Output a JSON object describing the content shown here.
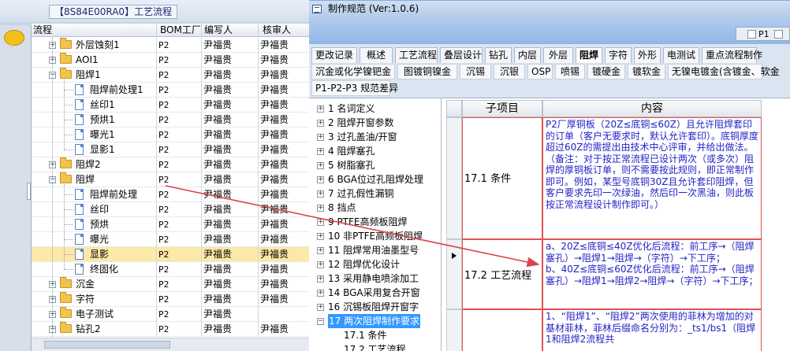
{
  "left_window": {
    "title": "【8S84E00RA0】工艺流程",
    "columns": [
      "流程",
      "BOM工厂",
      "编写人",
      "核审人"
    ],
    "rows": [
      {
        "label": "外层蚀刻1",
        "bom": "P2",
        "writer": "尹福贵",
        "reviewer": "尹福贵",
        "type": "folder",
        "level": 1,
        "exp": "+"
      },
      {
        "label": "AOI1",
        "bom": "P2",
        "writer": "尹福贵",
        "reviewer": "尹福贵",
        "type": "folder",
        "level": 1,
        "exp": "+"
      },
      {
        "label": "阻焊1",
        "bom": "P2",
        "writer": "尹福贵",
        "reviewer": "尹福贵",
        "type": "folder",
        "level": 1,
        "exp": "-"
      },
      {
        "label": "阻焊前处理1",
        "bom": "P2",
        "writer": "尹福贵",
        "reviewer": "尹福贵",
        "type": "doc",
        "level": 2
      },
      {
        "label": "丝印1",
        "bom": "P2",
        "writer": "尹福贵",
        "reviewer": "尹福贵",
        "type": "doc",
        "level": 2
      },
      {
        "label": "预烘1",
        "bom": "P2",
        "writer": "尹福贵",
        "reviewer": "尹福贵",
        "type": "doc",
        "level": 2
      },
      {
        "label": "曝光1",
        "bom": "P2",
        "writer": "尹福贵",
        "reviewer": "尹福贵",
        "type": "doc",
        "level": 2
      },
      {
        "label": "显影1",
        "bom": "P2",
        "writer": "尹福贵",
        "reviewer": "尹福贵",
        "type": "doc",
        "level": 2
      },
      {
        "label": "阻焊2",
        "bom": "P2",
        "writer": "尹福贵",
        "reviewer": "尹福贵",
        "type": "folder",
        "level": 1,
        "exp": "+"
      },
      {
        "label": "阻焊",
        "bom": "P2",
        "writer": "尹福贵",
        "reviewer": "尹福贵",
        "type": "folder",
        "level": 1,
        "exp": "-"
      },
      {
        "label": "阻焊前处理",
        "bom": "P2",
        "writer": "尹福贵",
        "reviewer": "尹福贵",
        "type": "doc",
        "level": 2
      },
      {
        "label": "丝印",
        "bom": "P2",
        "writer": "尹福贵",
        "reviewer": "尹福贵",
        "type": "doc",
        "level": 2
      },
      {
        "label": "预烘",
        "bom": "P2",
        "writer": "尹福贵",
        "reviewer": "尹福贵",
        "type": "doc",
        "level": 2
      },
      {
        "label": "曝光",
        "bom": "P2",
        "writer": "尹福贵",
        "reviewer": "尹福贵",
        "type": "doc",
        "level": 2
      },
      {
        "label": "显影",
        "bom": "P2",
        "writer": "尹福贵",
        "reviewer": "尹福贵",
        "type": "doc",
        "level": 2,
        "selected": true
      },
      {
        "label": "终固化",
        "bom": "P2",
        "writer": "尹福贵",
        "reviewer": "尹福贵",
        "type": "doc",
        "level": 2
      },
      {
        "label": "沉金",
        "bom": "P2",
        "writer": "尹福贵",
        "reviewer": "尹福贵",
        "type": "folder",
        "level": 1,
        "exp": "+"
      },
      {
        "label": "字符",
        "bom": "P2",
        "writer": "尹福贵",
        "reviewer": "尹福贵",
        "type": "folder",
        "level": 1,
        "exp": "+"
      },
      {
        "label": "电子测试",
        "bom": "P2",
        "writer": "尹福贵",
        "reviewer": "",
        "type": "folder",
        "level": 1,
        "exp": "+"
      },
      {
        "label": "钻孔2",
        "bom": "P2",
        "writer": "尹福贵",
        "reviewer": "尹福贵",
        "type": "folder",
        "level": 1,
        "exp": "+"
      }
    ]
  },
  "right_window": {
    "title": "制作规范 (Ver:1.0.6)",
    "p1_label": "P1",
    "tabs_row1": [
      "更改记录",
      "概述",
      "工艺流程",
      "叠层设计",
      "钻孔",
      "内层",
      "外层",
      "阻焊",
      "字符",
      "外形",
      "电测试",
      "重点流程制作"
    ],
    "tabs_row2": [
      "沉金或化学镍钯金",
      "图镀铜镍金",
      "沉锡",
      "沉银",
      "OSP",
      "喷锡",
      "镀硬金",
      "镀软金",
      "无镍电镀金(含镀金、软金"
    ],
    "tabs_row3": [
      "P1-P2-P3 规范差异"
    ],
    "active_tab": "阻焊",
    "tree": [
      {
        "text": "1 名词定义",
        "exp": "+"
      },
      {
        "text": "2 阻焊开窗参数",
        "exp": "+"
      },
      {
        "text": "3 过孔盖油/开窗",
        "exp": "+"
      },
      {
        "text": "4 阻焊塞孔",
        "exp": "+"
      },
      {
        "text": "5 树脂塞孔",
        "exp": "+"
      },
      {
        "text": "6 BGA位过孔阻焊处理",
        "exp": "+"
      },
      {
        "text": "7 过孔假性漏铜",
        "exp": "+"
      },
      {
        "text": "8 挡点",
        "exp": "+"
      },
      {
        "text": "9 PTFE高频板阻焊",
        "exp": "+"
      },
      {
        "text": "10 非PTFE高频板阻焊",
        "exp": "+"
      },
      {
        "text": "11 阻焊常用油墨型号",
        "exp": "+"
      },
      {
        "text": "12 阻焊优化设计",
        "exp": "+"
      },
      {
        "text": "13 采用静电喷涂加工",
        "exp": "+"
      },
      {
        "text": "14 BGA采用复合开窗",
        "exp": "+"
      },
      {
        "text": "16 沉锡板阻焊开窗字",
        "exp": "+"
      },
      {
        "text": "17 两次阻焊制作要求",
        "exp": "-",
        "selected": true
      },
      {
        "text": "17.1 条件",
        "child": true
      },
      {
        "text": "17.2 工艺流程",
        "child": true
      }
    ],
    "table": {
      "col_sub": "子项目",
      "col_content": "内容",
      "rows": [
        {
          "sub": "17.1 条件",
          "content": "P2厂厚铜板（20Z≤底铜≤60Z）且允许阻焊套印的订单（客户无要求时，默认允许套印）。底铜厚度超过60Z的需提出由技术中心评审，并给出做法。（备注：对于按正常流程已设计两次（或多次）阻焊的厚铜板订单，则不需要按此规则，即正常制作即可。例如，某型号底铜30Z且允许套印阻焊，但客户要求先印一次绿油，然后印一次黑油，则此板按正常流程设计制作即可。）"
        },
        {
          "sub": "17.2 工艺流程",
          "content": "a、20Z≤底铜≤40Z优化后流程：前工序→（阻焊塞孔）→阻焊1→阻焊→（字符）→下工序；\nb、40Z≤底铜≤60Z优化后流程：前工序→（阻焊塞孔）→阻焊1→阻焊2→阻焊→（字符）→下工序；"
        },
        {
          "sub": "",
          "content": "1、“阻焊1”、“阻焊2”两次使用的菲林为增加的对基材菲林，菲林后缀命名分别为：_ts1/bs1（阻焊1和阻焊2流程共"
        }
      ]
    }
  }
}
